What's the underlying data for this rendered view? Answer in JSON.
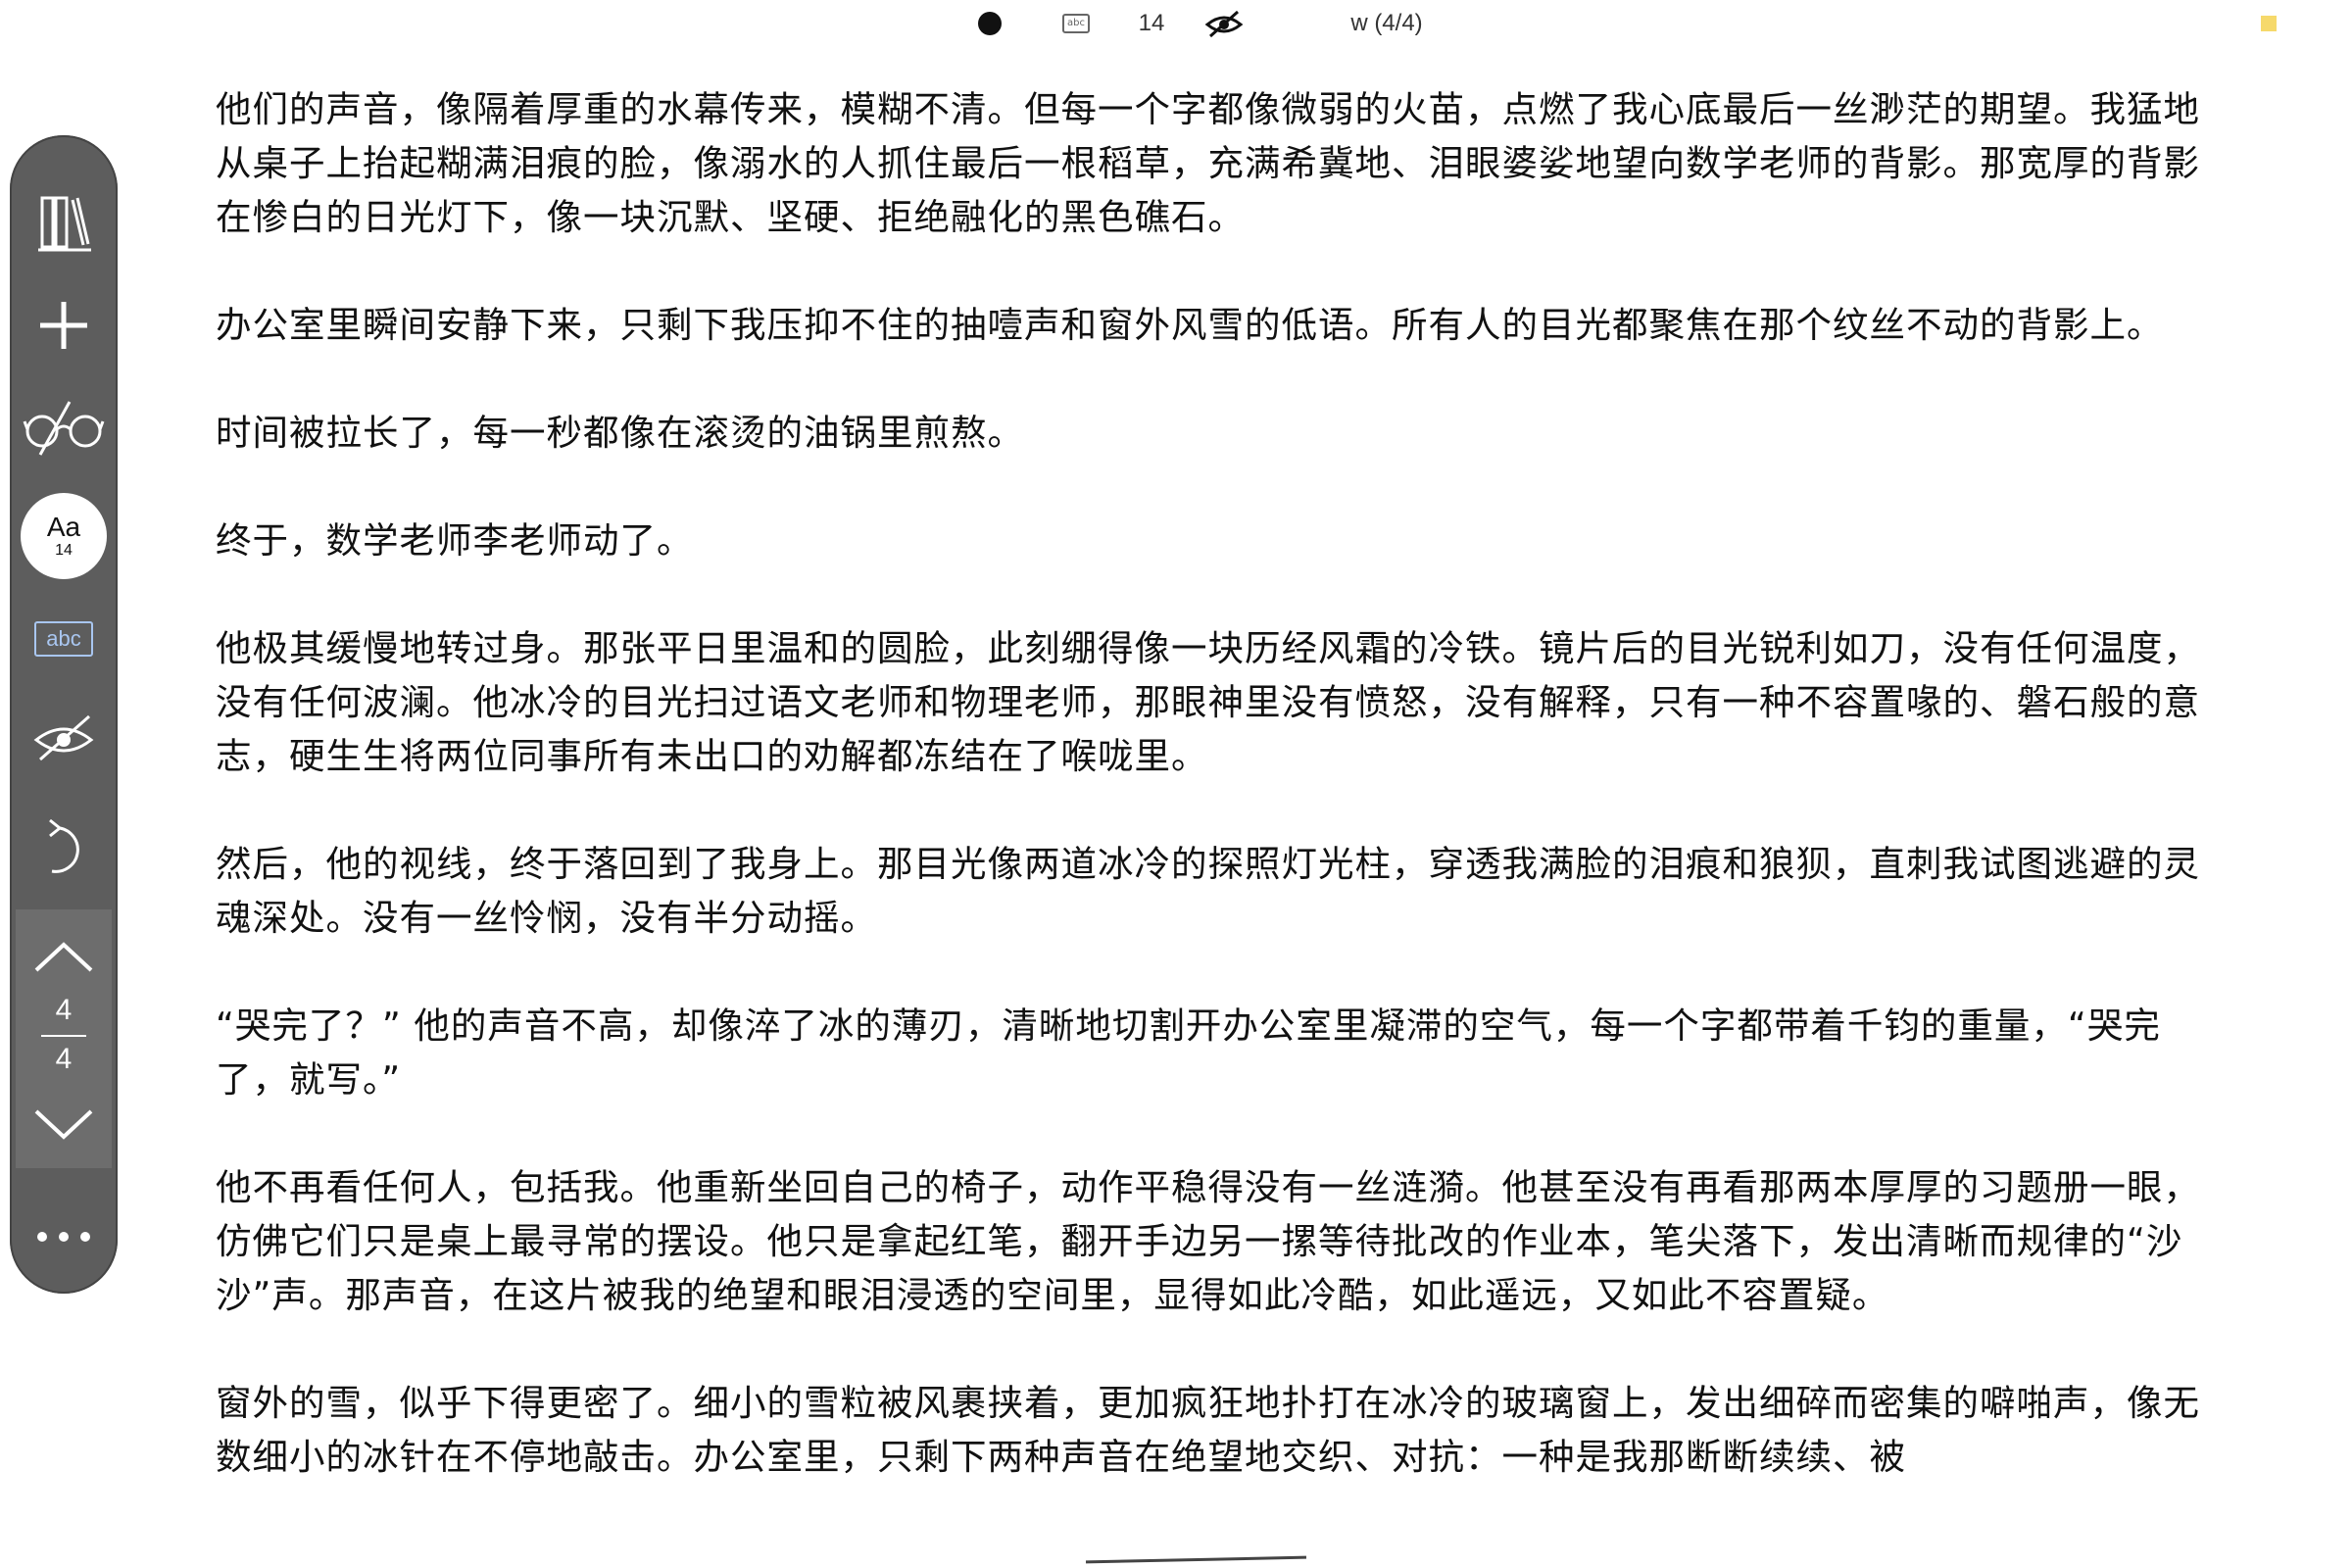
{
  "status_bar": {
    "font_size": "14",
    "page_info": "w (4/4)"
  },
  "toolbar": {
    "font_button_label": "Aa",
    "font_button_size": "14",
    "spell_label": "abc",
    "page_current": "4",
    "page_total": "4"
  },
  "content": {
    "paragraphs": [
      "他们的声音，像隔着厚重的水幕传来，模糊不清。但每一个字都像微弱的火苗，点燃了我心底最后一丝渺茫的期望。我猛地从桌子上抬起糊满泪痕的脸，像溺水的人抓住最后一根稻草，充满希冀地、泪眼婆娑地望向数学老师的背影。那宽厚的背影在惨白的日光灯下，像一块沉默、坚硬、拒绝融化的黑色礁石。",
      "办公室里瞬间安静下来，只剩下我压抑不住的抽噎声和窗外风雪的低语。所有人的目光都聚焦在那个纹丝不动的背影上。",
      "时间被拉长了，每一秒都像在滚烫的油锅里煎熬。",
      "终于，数学老师李老师动了。",
      "他极其缓慢地转过身。那张平日里温和的圆脸，此刻绷得像一块历经风霜的冷铁。镜片后的目光锐利如刀，没有任何温度，没有任何波澜。他冰冷的目光扫过语文老师和物理老师，那眼神里没有愤怒，没有解释，只有一种不容置喙的、磐石般的意志，硬生生将两位同事所有未出口的劝解都冻结在了喉咙里。",
      "然后，他的视线，终于落回到了我身上。那目光像两道冰冷的探照灯光柱，穿透我满脸的泪痕和狼狈，直刺我试图逃避的灵魂深处。没有一丝怜悯，没有半分动摇。",
      "“哭完了？” 他的声音不高，却像淬了冰的薄刃，清晰地切割开办公室里凝滞的空气，每一个字都带着千钧的重量，“哭完了，就写。”",
      "他不再看任何人，包括我。他重新坐回自己的椅子，动作平稳得没有一丝涟漪。他甚至没有再看那两本厚厚的习题册一眼，仿佛它们只是桌上最寻常的摆设。他只是拿起红笔，翻开手边另一摞等待批改的作业本，笔尖落下，发出清晰而规律的“沙沙”声。那声音，在这片被我的绝望和眼泪浸透的空间里，显得如此冷酷，如此遥远，又如此不容置疑。",
      "窗外的雪，似乎下得更密了。细小的雪粒被风裹挟着，更加疯狂地扑打在冰冷的玻璃窗上，发出细碎而密集的噼啪声，像无数细小的冰针在不停地敲击。办公室里，只剩下两种声音在绝望地交织、对抗：一种是我那断断续续、被"
    ]
  }
}
